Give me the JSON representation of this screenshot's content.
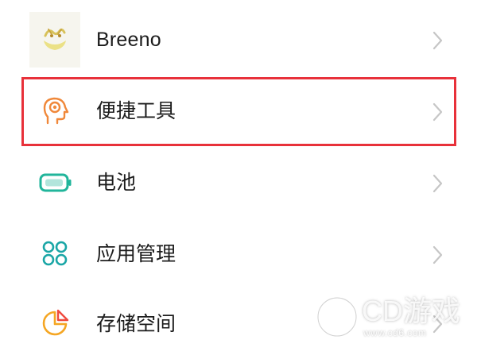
{
  "settings": {
    "items": [
      {
        "label": "Breeno",
        "icon": "breeno-app-icon"
      },
      {
        "label": "便捷工具",
        "icon": "convenience-tools-icon",
        "highlighted": true
      },
      {
        "label": "电池",
        "icon": "battery-icon"
      },
      {
        "label": "应用管理",
        "icon": "app-management-icon"
      },
      {
        "label": "存储空间",
        "icon": "storage-icon"
      }
    ],
    "chevron_icon": "chevron-right-icon",
    "highlight_color": "#e8313a",
    "accent_colors": {
      "convenience_tools": "#f0883a",
      "battery": "#21b59b",
      "app_management": "#1aa6a6",
      "storage": "#f5a623"
    }
  },
  "watermark": {
    "text": "CD游戏",
    "url": "www.cd6.com"
  }
}
